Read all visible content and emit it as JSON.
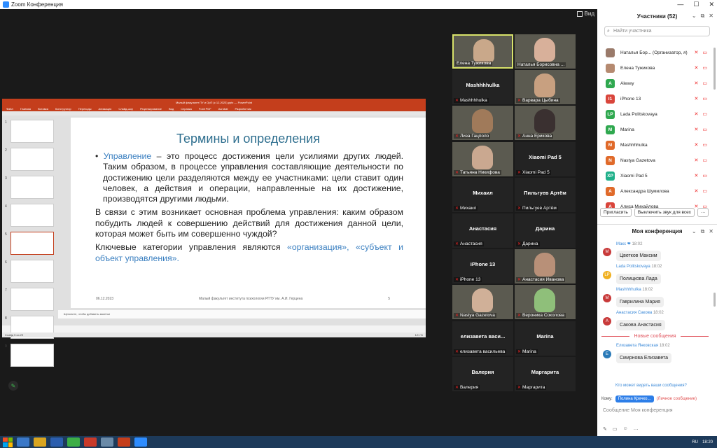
{
  "window": {
    "title": "Zoom Конференция",
    "min": "—",
    "max": "☐",
    "close": "✕"
  },
  "view_label": "Вид",
  "ppt": {
    "title": "Малый факультет ПУ и ОрП (с 12.2023).pptx — PowerPoint",
    "menu": [
      "Файл",
      "Главная",
      "Вставка",
      "Конструктор",
      "Переходы",
      "Анимация",
      "Слайд-шоу",
      "Рецензирование",
      "Вид",
      "Справка",
      "Foxit PDF",
      "Acrobat",
      "Разработчик"
    ],
    "slide_numbers": [
      "1",
      "2",
      "3",
      "4",
      "5",
      "6",
      "7",
      "8",
      "9"
    ],
    "selected_slide": 5,
    "slide": {
      "title": "Термины  и определения",
      "bullet_term": "Управление",
      "bullet_rest": " – это процесс достижения цели усилиями других людей. Таким образом, в процессе управления составляющие деятельности по достижению цели разделяются между ее участниками: цели ставит один человек, а действия и операции, направленные на их достижение, производятся другими людьми.",
      "p2": "В связи с этим возникает основная проблема управления: каким образом побудить людей к совершению действий для достижения данной цели, которая может быть им совершенно чуждой?",
      "p3_start": "Ключевые категории управления являются ",
      "p3_hl": "«организация», «субъект и объект управления».",
      "footer_date": "06.12.2023",
      "footer_center": "Малый факультет института психологии РГПУ им. А.И. Герцена",
      "footer_num": "5"
    },
    "notes": "Щелкните, чтобы добавить заметки",
    "status_left": "Слайд 5 из 29",
    "status_zoom": "121 %"
  },
  "gallery": [
    {
      "name": "Елена Тужикова",
      "big": "",
      "video": true,
      "active": true,
      "muted": false,
      "face": "#c9a88a"
    },
    {
      "name": "Наталья Борисовна ...",
      "big": "",
      "video": true,
      "active": false,
      "muted": false,
      "face": "#d8b09a"
    },
    {
      "name": "Mashhhhulka",
      "big": "Mashhhhulka",
      "video": false,
      "active": false,
      "muted": true,
      "face": ""
    },
    {
      "name": "Варвара Цыбина",
      "big": "",
      "video": true,
      "active": false,
      "muted": true,
      "face": "#c8a080"
    },
    {
      "name": "Лиза Гацполо",
      "big": "",
      "video": true,
      "active": false,
      "muted": true,
      "face": "#a07a5a"
    },
    {
      "name": "Анна Ерикова",
      "big": "",
      "video": true,
      "active": false,
      "muted": true,
      "face": "#3a3030"
    },
    {
      "name": "Татьяна Никифова",
      "big": "",
      "video": true,
      "active": false,
      "muted": true,
      "face": "#caa890"
    },
    {
      "name": "Xiaomi Pad 5",
      "big": "Xiaomi Pad 5",
      "video": false,
      "active": false,
      "muted": true,
      "face": ""
    },
    {
      "name": "Михаил",
      "big": "Михаил",
      "video": false,
      "active": false,
      "muted": true,
      "face": ""
    },
    {
      "name": "Пильгуев Артём",
      "big": "Пильгуев Артём",
      "video": false,
      "active": false,
      "muted": true,
      "face": ""
    },
    {
      "name": "Анастасия",
      "big": "Анастасия",
      "video": false,
      "active": false,
      "muted": true,
      "face": ""
    },
    {
      "name": "Дарина",
      "big": "Дарина",
      "video": false,
      "active": false,
      "muted": true,
      "face": ""
    },
    {
      "name": "iPhone 13",
      "big": "iPhone 13",
      "video": false,
      "active": false,
      "muted": true,
      "face": ""
    },
    {
      "name": "Анастасия Иванова",
      "big": "",
      "video": true,
      "active": false,
      "muted": true,
      "face": "#b89078"
    },
    {
      "name": "Nastya Gazetova",
      "big": "",
      "video": true,
      "active": false,
      "muted": true,
      "face": "#d0b098"
    },
    {
      "name": "Вероника Соколова",
      "big": "",
      "video": true,
      "active": false,
      "muted": true,
      "face": "#8fbf7a"
    },
    {
      "name": "елизавета васильева",
      "big": "елизавета васи...",
      "video": false,
      "active": false,
      "muted": true,
      "face": ""
    },
    {
      "name": "Marina",
      "big": "Marina",
      "video": false,
      "active": false,
      "muted": true,
      "face": ""
    },
    {
      "name": "Валерия",
      "big": "Валерия",
      "video": false,
      "active": false,
      "muted": true,
      "face": ""
    },
    {
      "name": "Маргарита",
      "big": "Маргарита",
      "video": false,
      "active": false,
      "muted": true,
      "face": ""
    }
  ],
  "participants": {
    "title": "Участники (52)",
    "search_placeholder": "Найти участника",
    "list": [
      {
        "name": "Наталья Бор...  (Организатор, я)",
        "initials": "",
        "color": "#9a7a6a"
      },
      {
        "name": "Елена Тужикова",
        "initials": "",
        "color": "#b58a70"
      },
      {
        "name": "Alexey",
        "initials": "A",
        "color": "#2fa84f"
      },
      {
        "name": "iPhone 13",
        "initials": "I1",
        "color": "#d9453b"
      },
      {
        "name": "Lada Politskovaya",
        "initials": "LP",
        "color": "#2fa84f"
      },
      {
        "name": "Marina",
        "initials": "M",
        "color": "#2fa84f"
      },
      {
        "name": "Mashhhhulka",
        "initials": "M",
        "color": "#e06a2a"
      },
      {
        "name": "Nastya Gazetova",
        "initials": "N",
        "color": "#e06a2a"
      },
      {
        "name": "Xiaomi Pad 5",
        "initials": "XP",
        "color": "#1fb08a"
      },
      {
        "name": "Александра Шумилова",
        "initials": "А",
        "color": "#e06a2a"
      },
      {
        "name": "Алиса Михайлова",
        "initials": "А",
        "color": "#d9453b"
      }
    ],
    "invite": "Пригласить",
    "mute_all": "Выключить звук для всех",
    "more": "···"
  },
  "chat": {
    "title": "Моя конференция",
    "messages": [
      {
        "who": "Макс ❤",
        "time": "18:02",
        "text": "Цветков Максим",
        "initials": "M",
        "color": "#c83a3a"
      },
      {
        "who": "Lada Politskovaya",
        "time": "18:02",
        "text": "Полицкова Лада",
        "initials": "LP",
        "color": "#f0b020"
      },
      {
        "who": "Mashhhhulka",
        "time": "18:02",
        "text": "Гаврилина Мария",
        "initials": "M",
        "color": "#c83a3a"
      },
      {
        "who": "Анастасия Сакова",
        "time": "18:02",
        "text": "Сакова Анастасия",
        "initials": "А",
        "color": "#c83a3a"
      }
    ],
    "new_divider": "Новые сообщения",
    "new_message": {
      "who": "Елизавета Янковская",
      "time": "18:02",
      "text": "Смирнова Елизавета",
      "initials": "Е",
      "color": "#2a7ab8"
    },
    "who_can_see": "Кто может видеть ваши сообщения?",
    "to_label": "Кому:",
    "to_value": "Полина Кречко...",
    "private_label": "(Личное сообщение)",
    "input_placeholder": "Сообщение Моя конференция"
  },
  "taskbar": {
    "lang": "RU",
    "time": "18:20"
  }
}
